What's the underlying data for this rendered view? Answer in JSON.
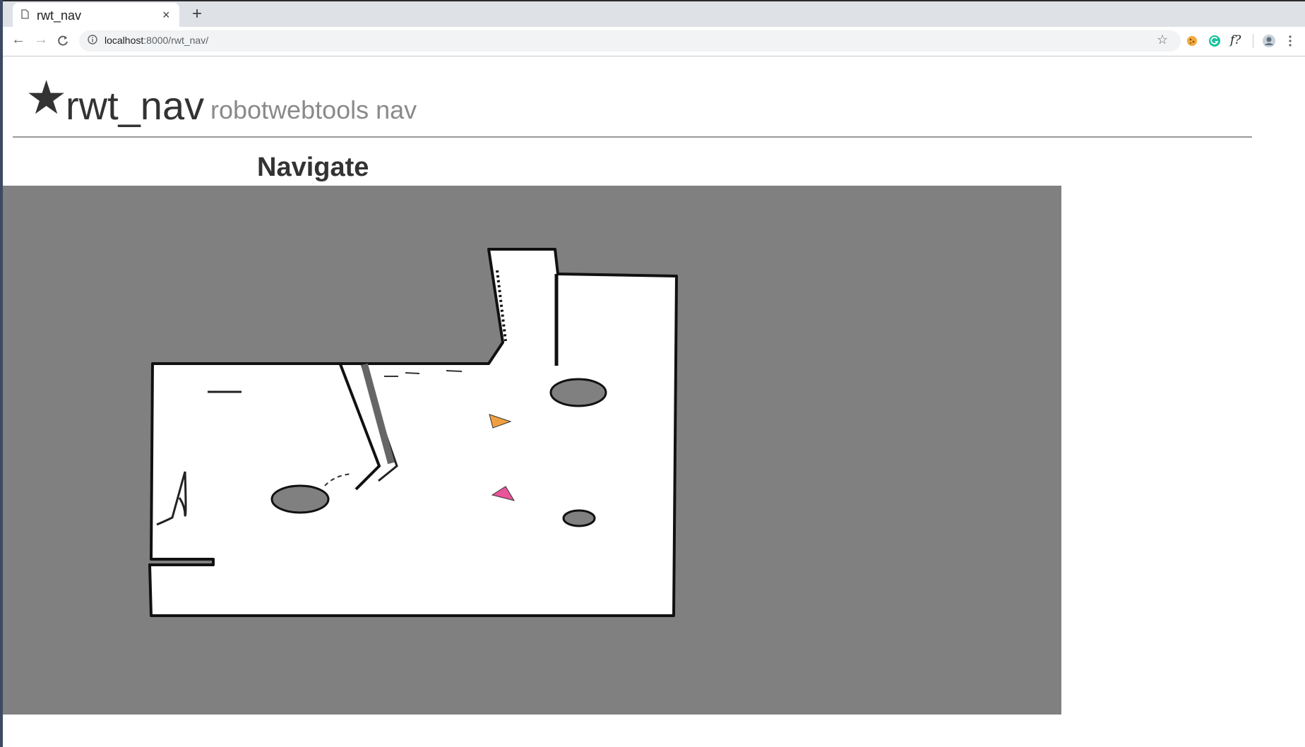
{
  "browser": {
    "tab_title": "rwt_nav",
    "tab_close": "×",
    "new_tab": "+",
    "url_host": "localhost",
    "url_path": ":8000/rwt_nav/",
    "extensions": [
      "cookie-icon",
      "grammarly-icon",
      "formula-icon"
    ],
    "extension_formula_label": "f?",
    "accent_color": "#1da851"
  },
  "page": {
    "star_glyph": "★",
    "title": "rwt_nav",
    "subtitle": "robotwebtools nav",
    "heading": "Navigate"
  },
  "map": {
    "background_color": "#808080",
    "free_space_color": "#ffffff",
    "robot_marker_color": "#f0a040",
    "goal_marker_color": "#e8559a"
  }
}
